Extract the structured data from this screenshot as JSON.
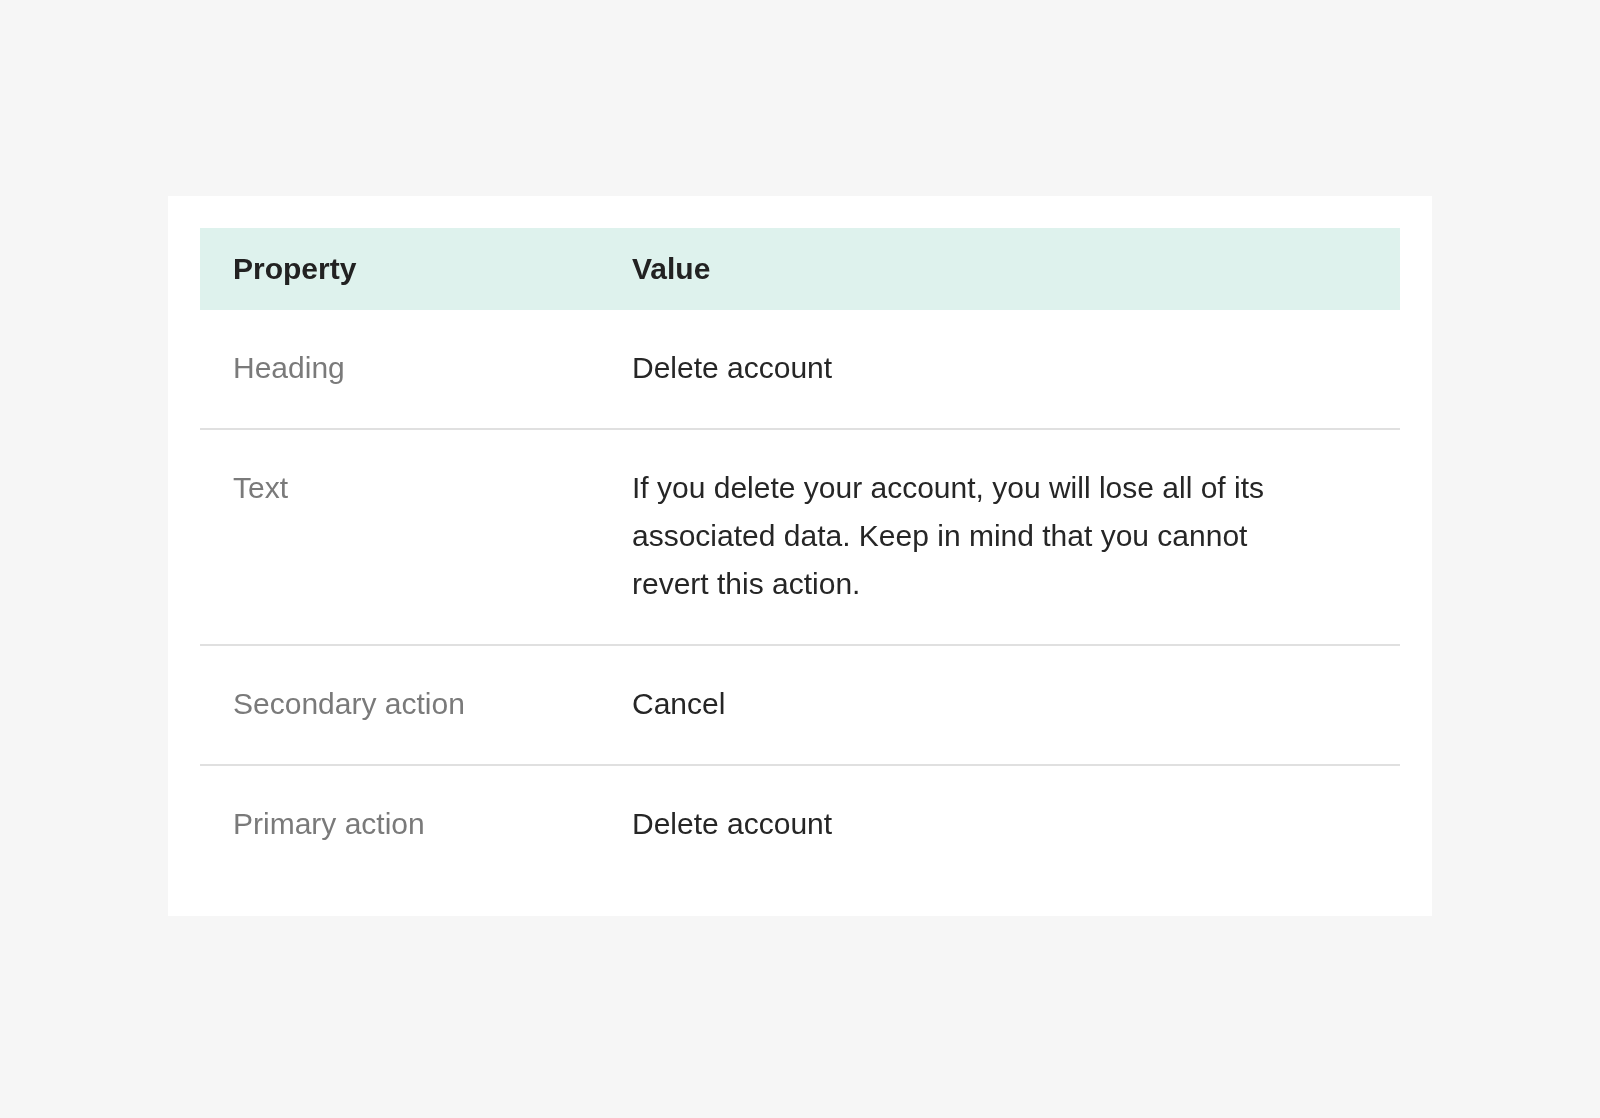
{
  "table": {
    "columns": [
      "Property",
      "Value"
    ],
    "rows": [
      {
        "property": "Heading",
        "value": "Delete account"
      },
      {
        "property": "Text",
        "value": "If you delete your account, you will lose all of its associated data. Keep in mind that you cannot revert this action."
      },
      {
        "property": "Secondary action",
        "value": "Cancel"
      },
      {
        "property": "Primary action",
        "value": "Delete account"
      }
    ]
  }
}
